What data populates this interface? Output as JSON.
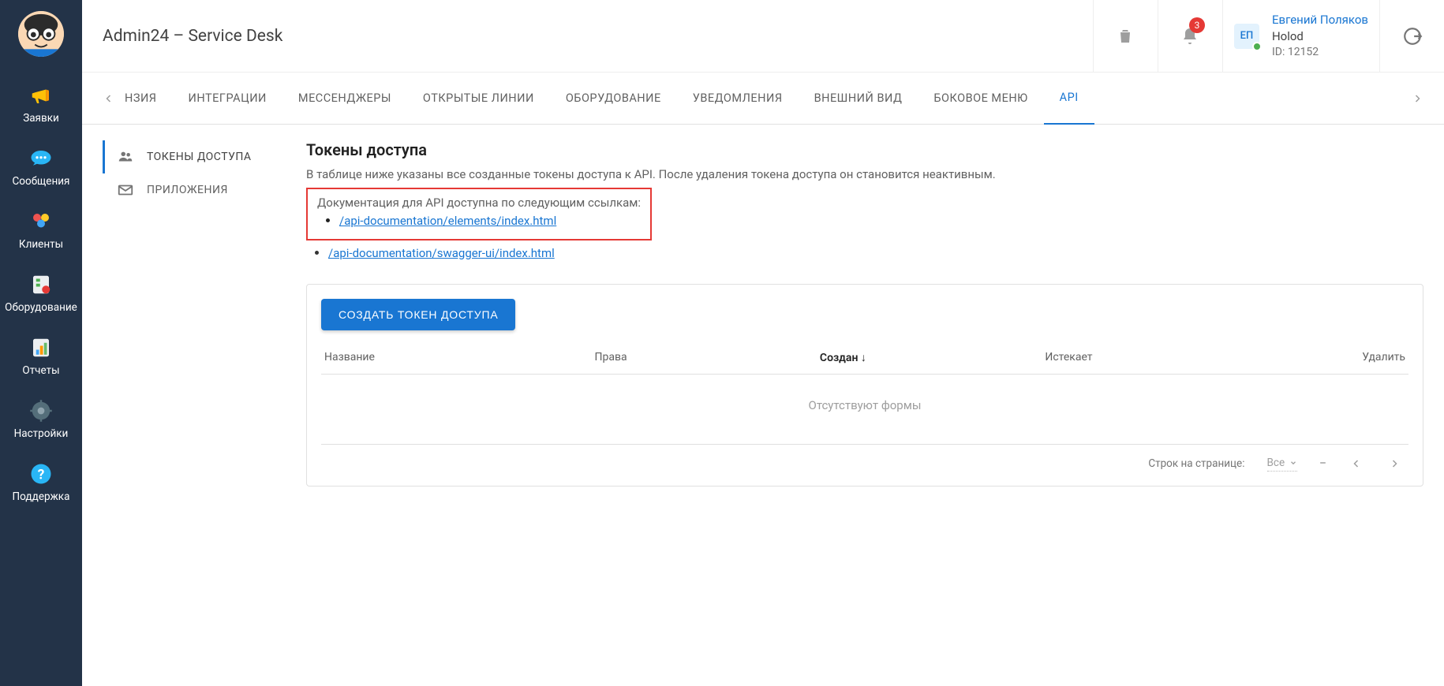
{
  "header": {
    "app_title": "Admin24 – Service Desk",
    "notification_count": "3",
    "user_initials": "ЕП",
    "user_name": "Евгений Поляков",
    "user_org": "Holod",
    "user_id": "ID: 12152"
  },
  "sidebar": {
    "items": [
      {
        "label": "Заявки",
        "icon": "megaphone"
      },
      {
        "label": "Сообщения",
        "icon": "chat"
      },
      {
        "label": "Клиенты",
        "icon": "people"
      },
      {
        "label": "Оборудование",
        "icon": "equipment"
      },
      {
        "label": "Отчеты",
        "icon": "reports"
      },
      {
        "label": "Настройки",
        "icon": "gear"
      },
      {
        "label": "Поддержка",
        "icon": "help"
      }
    ]
  },
  "tabs": {
    "partial": "НЗИЯ",
    "items": [
      "ИНТЕГРАЦИИ",
      "МЕССЕНДЖЕРЫ",
      "ОТКРЫТЫЕ ЛИНИИ",
      "ОБОРУДОВАНИЕ",
      "УВЕДОМЛЕНИЯ",
      "ВНЕШНИЙ ВИД",
      "БОКОВОЕ МЕНЮ",
      "API"
    ],
    "active": "API"
  },
  "subnav": {
    "items": [
      {
        "label": "ТОКЕНЫ ДОСТУПА",
        "icon": "group",
        "active": true
      },
      {
        "label": "ПРИЛОЖЕНИЯ",
        "icon": "mail",
        "active": false
      }
    ]
  },
  "page": {
    "title": "Токены доступа",
    "description": "В таблице ниже указаны все созданные токены доступа к API. После удаления токена доступа он становится неактивным.",
    "doc_label": "Документация для API доступна по следующим ссылкам:",
    "doc_links": [
      "/api-documentation/elements/index.html",
      "/api-documentation/swagger-ui/index.html"
    ],
    "create_button": "СОЗДАТЬ ТОКЕН ДОСТУПА",
    "columns": {
      "name": "Название",
      "rights": "Права",
      "created": "Создан",
      "expires": "Истекает",
      "delete": "Удалить"
    },
    "empty_text": "Отсутствуют формы",
    "pager": {
      "rows_label": "Строк на странице:",
      "rows_value": "Все",
      "range": "–"
    }
  }
}
